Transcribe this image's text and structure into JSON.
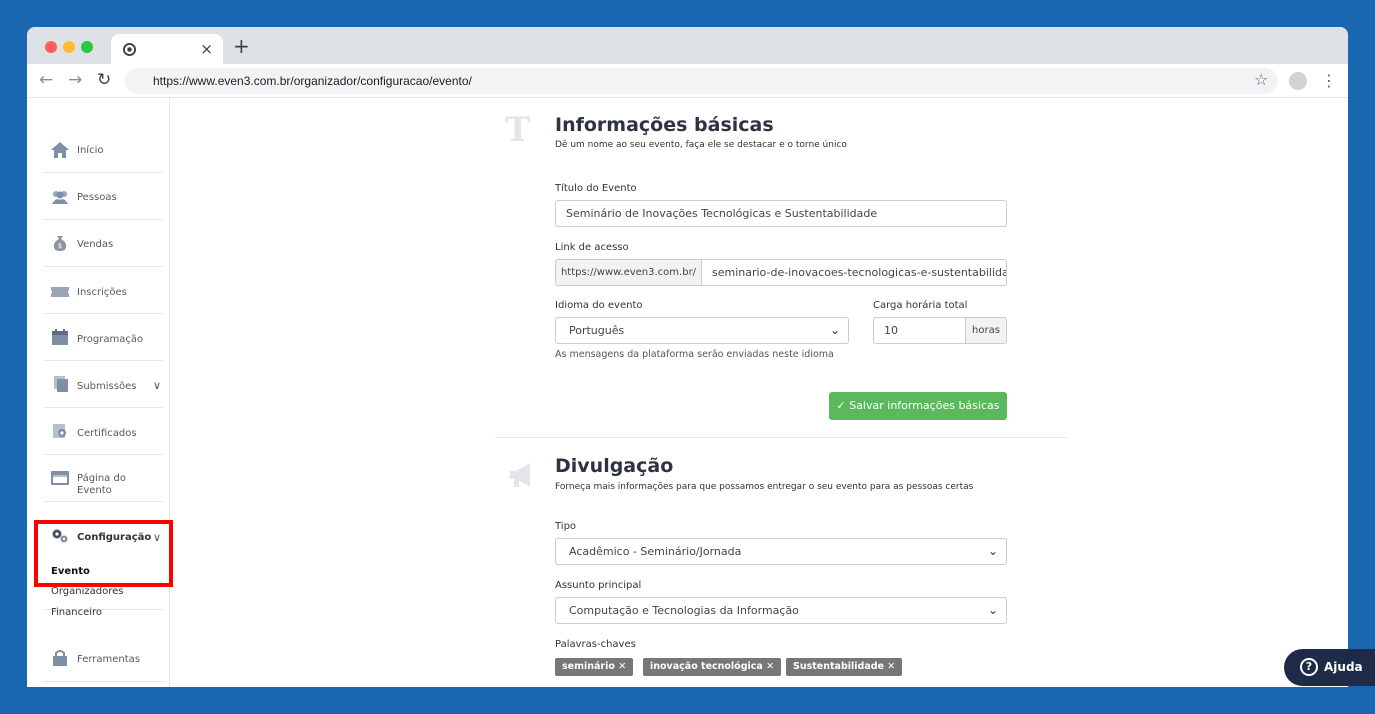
{
  "browser": {
    "url": "https://www.even3.com.br/organizador/configuracao/evento/",
    "tab_close": "×",
    "new_tab": "+"
  },
  "sidebar": {
    "items": [
      {
        "label": "Início",
        "icon": "home-icon"
      },
      {
        "label": "Pessoas",
        "icon": "people-icon"
      },
      {
        "label": "Vendas",
        "icon": "money-bag-icon"
      },
      {
        "label": "Inscrições",
        "icon": "ticket-icon"
      },
      {
        "label": "Programação",
        "icon": "calendar-icon"
      },
      {
        "label": "Submissões",
        "icon": "documents-icon"
      },
      {
        "label": "Certificados",
        "icon": "certificate-icon"
      },
      {
        "label": "Página do Evento",
        "icon": "page-icon"
      },
      {
        "label": "Configuração",
        "icon": "gears-icon"
      },
      {
        "label": "Ferramentas",
        "icon": "bag-icon"
      }
    ],
    "config_subitems": [
      "Evento",
      "Organizadores",
      "Financeiro"
    ]
  },
  "basic_info": {
    "title": "Informações básicas",
    "subtitle": "Dê um nome ao seu evento, faça ele se destacar e o torne único",
    "event_title_label": "Título do Evento",
    "event_title_value": "Seminário de Inovações Tecnológicas e Sustentabilidade",
    "link_label": "Link de acesso",
    "link_prefix": "https://www.even3.com.br/",
    "link_slug": "seminario-de-inovacoes-tecnologicas-e-sustentabilidade",
    "language_label": "Idioma do evento",
    "language_value": "Português",
    "language_helper": "As mensagens da plataforma serão enviadas neste idioma",
    "workload_label": "Carga horária total",
    "workload_value": "10",
    "workload_unit": "horas",
    "save_label": "✓ Salvar informações básicas"
  },
  "promotion": {
    "title": "Divulgação",
    "subtitle": "Forneça mais informações para que possamos entregar o seu evento para as pessoas certas",
    "type_label": "Tipo",
    "type_value": "Acadêmico - Seminário/Jornada",
    "subject_label": "Assunto principal",
    "subject_value": "Computação e Tecnologias da Informação",
    "keywords_label": "Palavras-chaves",
    "keywords": [
      "seminário ✕",
      "inovação tecnológica ✕",
      "Sustentabilidade ✕"
    ]
  },
  "help": {
    "label": "Ajuda",
    "icon_glyph": "?"
  }
}
